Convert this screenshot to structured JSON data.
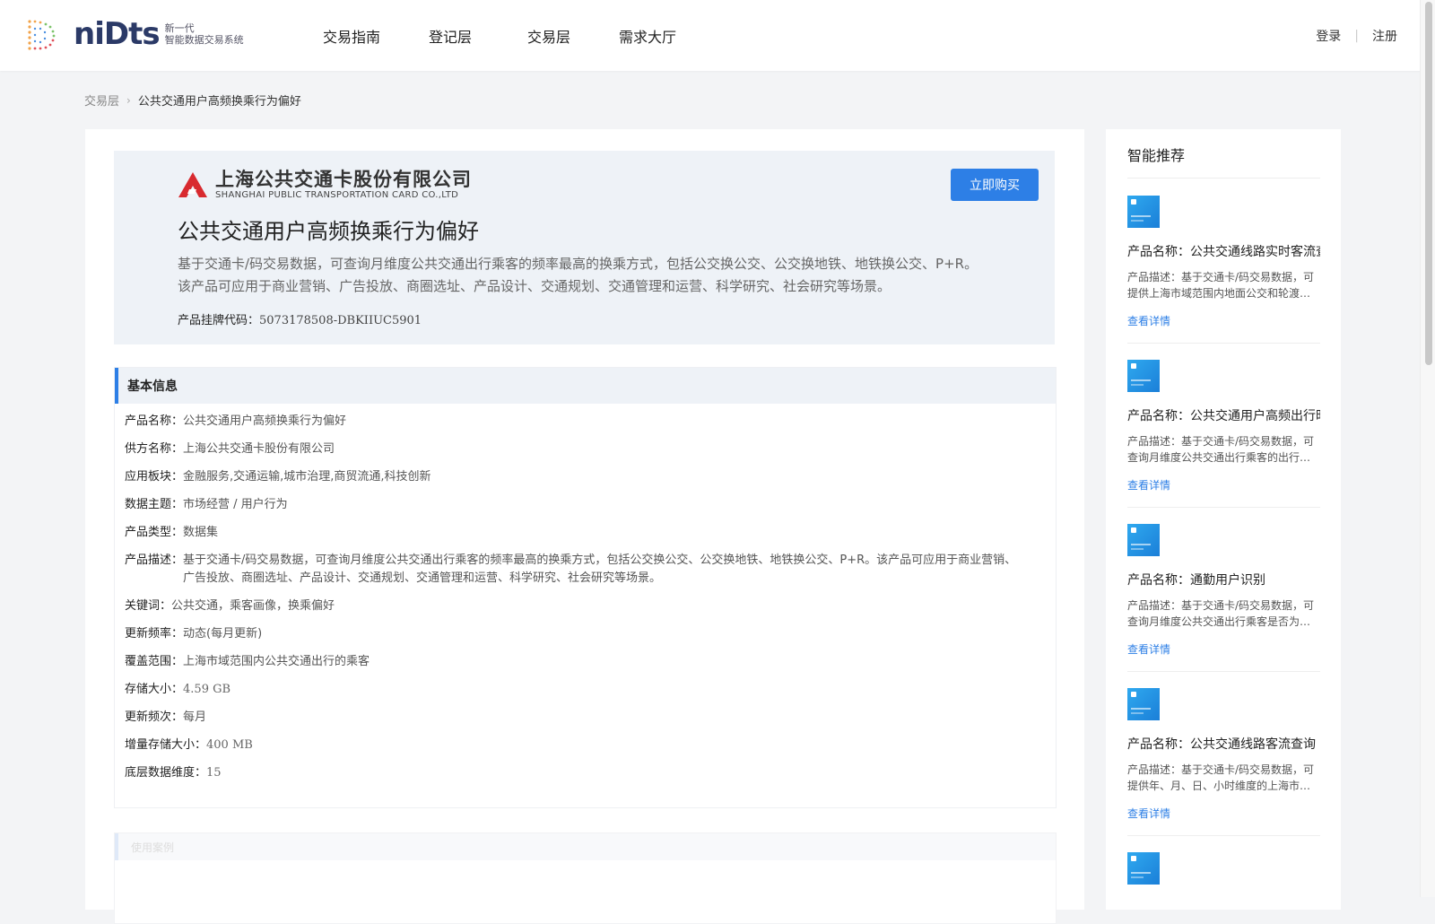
{
  "header": {
    "logo_word": "niDts",
    "logo_sub_line1": "新一代",
    "logo_sub_line2": "智能数据交易系统",
    "nav": [
      "交易指南",
      "登记层",
      "交易层",
      "需求大厅"
    ],
    "login": "登录",
    "separator": "|",
    "register": "注册"
  },
  "breadcrumb": {
    "parent": "交易层",
    "separator": "›",
    "current": "公共交通用户高频换乘行为偏好"
  },
  "product": {
    "company_cn": "上海公共交通卡股份有限公司",
    "company_en": "SHANGHAI PUBLIC TRANSPORTATION CARD CO.,LTD",
    "buy_label": "立即购买",
    "title": "公共交通用户高频换乘行为偏好",
    "description": "基于交通卡/码交易数据，可查询月维度公共交通出行乘客的频率最高的换乘方式，包括公交换公交、公交换地铁、地铁换公交、P+R。该产品可应用于商业营销、广告投放、商圈选址、产品设计、交通规划、交通管理和运营、科学研究、社会研究等场景。",
    "code_label": "产品挂牌代码：",
    "code_value": "5073178508-DBKIIUC5901"
  },
  "basic_info": {
    "heading": "基本信息",
    "rows": [
      {
        "key": "产品名称：",
        "value": "公共交通用户高频换乘行为偏好"
      },
      {
        "key": "供方名称：",
        "value": "上海公共交通卡股份有限公司"
      },
      {
        "key": "应用板块：",
        "value": "金融服务,交通运输,城市治理,商贸流通,科技创新"
      },
      {
        "key": "数据主题：",
        "value": "市场经营 / 用户行为"
      },
      {
        "key": "产品类型：",
        "value": "数据集"
      },
      {
        "key": "产品描述：",
        "value": "基于交通卡/码交易数据，可查询月维度公共交通出行乘客的频率最高的换乘方式，包括公交换公交、公交换地铁、地铁换公交、P+R。该产品可应用于商业营销、广告投放、商圈选址、产品设计、交通规划、交通管理和运营、科学研究、社会研究等场景。"
      },
      {
        "key": "关键词：",
        "value": "公共交通，乘客画像，换乘偏好"
      },
      {
        "key": "更新频率：",
        "value": "动态(每月更新)"
      },
      {
        "key": "覆盖范围：",
        "value": "上海市域范围内公共交通出行的乘客"
      },
      {
        "key": "存储大小：",
        "value": "4.59 GB"
      },
      {
        "key": "更新频次：",
        "value": "每月"
      },
      {
        "key": "增量存储大小：",
        "value": "400 MB"
      },
      {
        "key": "底层数据维度：",
        "value": "15"
      }
    ]
  },
  "faded_section": {
    "heading": "使用案例"
  },
  "recommend": {
    "title": "智能推荐",
    "items": [
      {
        "name": "产品名称：公共交通线路实时客流查询",
        "desc": "产品描述：基于交通卡/码交易数据，可提供上海市域范围内地面公交和轮渡…",
        "link": "查看详情"
      },
      {
        "name": "产品名称：公共交通用户高频出行时段",
        "desc": "产品描述：基于交通卡/码交易数据，可查询月维度公共交通出行乘客的出行…",
        "link": "查看详情"
      },
      {
        "name": "产品名称：通勤用户识别",
        "desc": "产品描述：基于交通卡/码交易数据，可查询月维度公共交通出行乘客是否为…",
        "link": "查看详情"
      },
      {
        "name": "产品名称：公共交通线路客流查询",
        "desc": "产品描述：基于交通卡/码交易数据，可提供年、月、日、小时维度的上海市…",
        "link": "查看详情"
      }
    ]
  },
  "colors": {
    "accent": "#2d7fe6",
    "hero_bg": "#eef2f7",
    "page_bg": "#f3f4f6"
  }
}
